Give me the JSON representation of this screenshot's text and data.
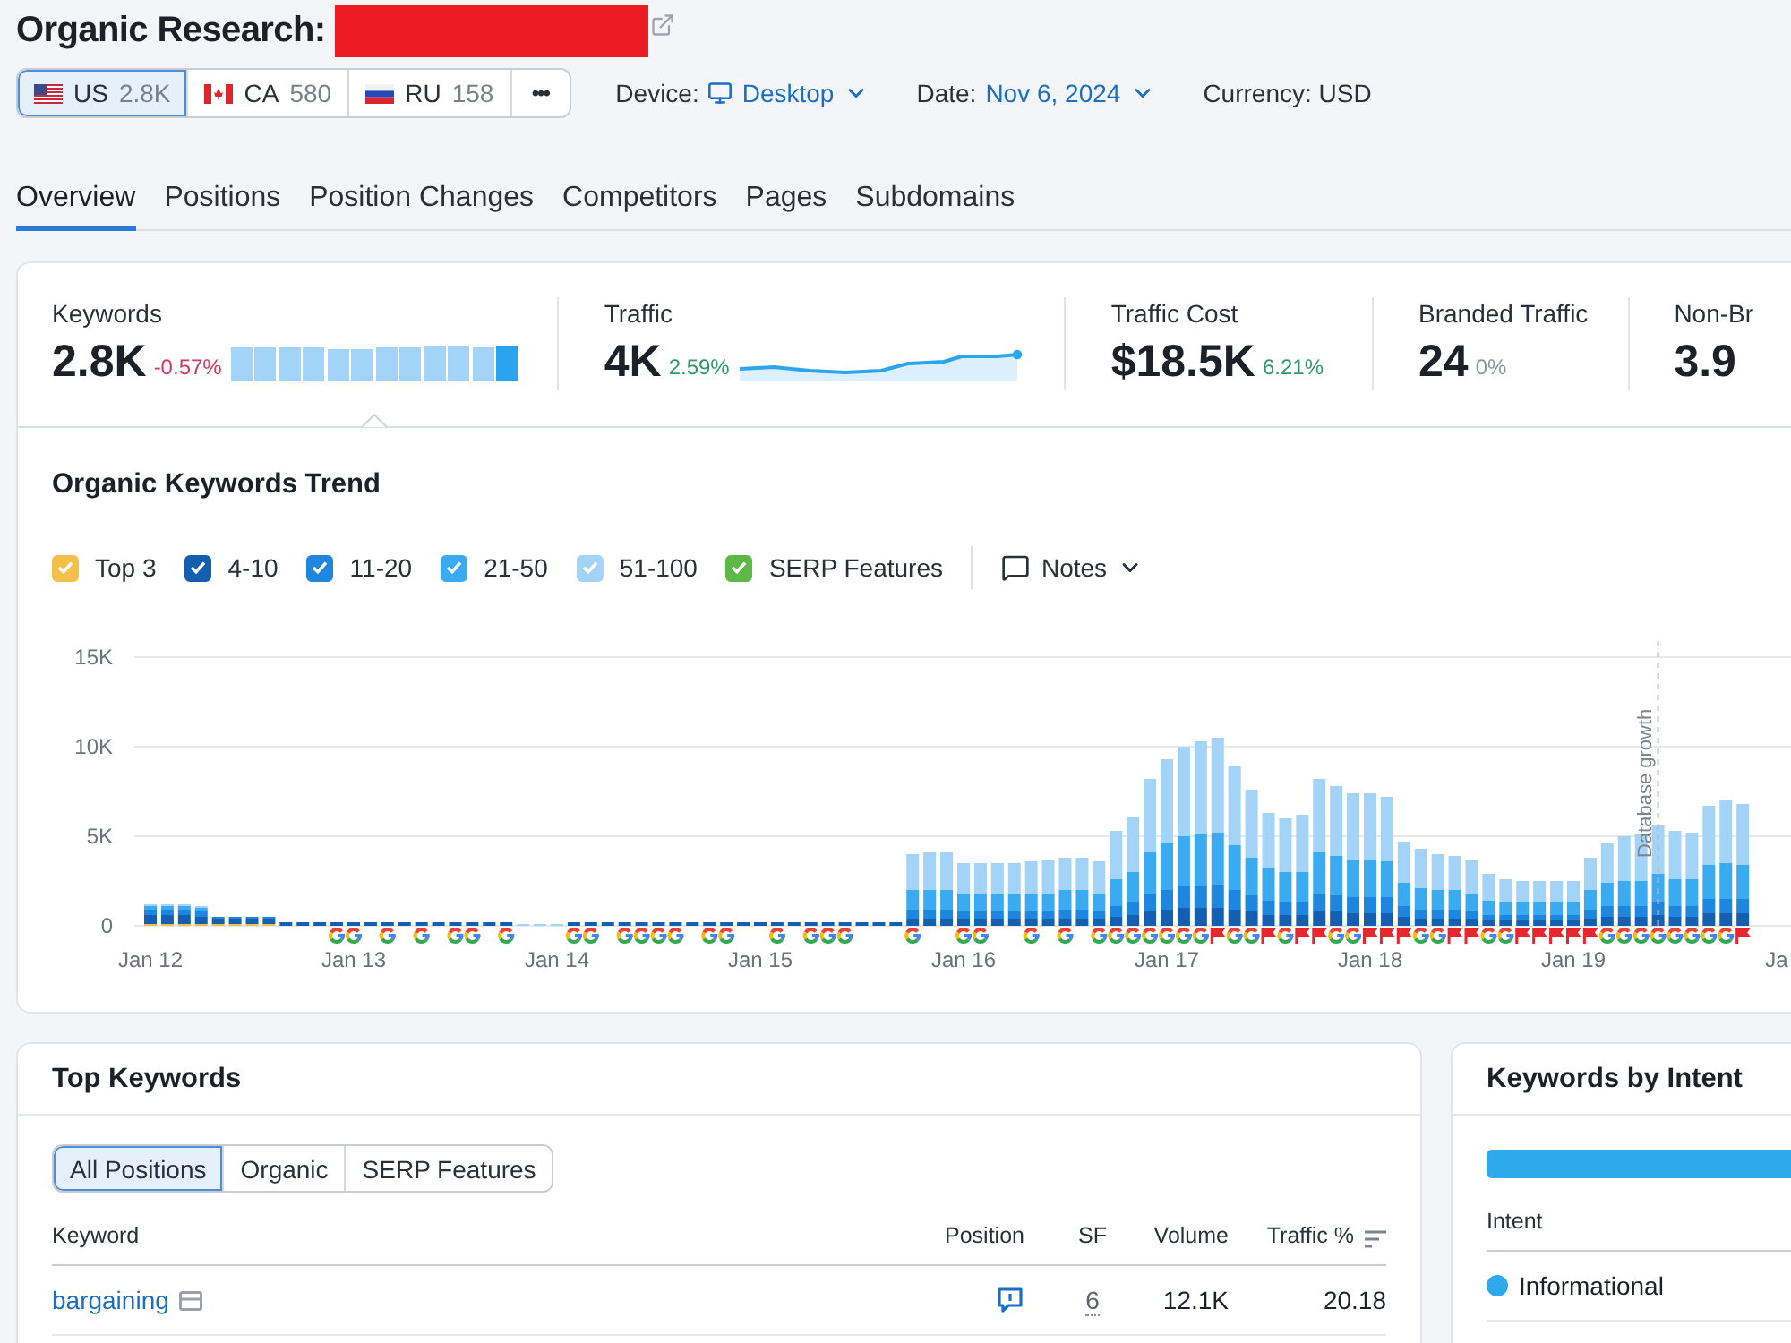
{
  "title": "Organic Research:",
  "domain": {
    "redacted": true
  },
  "databases": [
    {
      "code": "US",
      "count": "2.8K",
      "kind": "us",
      "selected": true
    },
    {
      "code": "CA",
      "count": "580",
      "kind": "ca",
      "selected": false
    },
    {
      "code": "RU",
      "count": "158",
      "kind": "ru",
      "selected": false
    }
  ],
  "more_button": {
    "label": "•••"
  },
  "device": {
    "label": "Device:",
    "value": "Desktop"
  },
  "date": {
    "label": "Date:",
    "value": "Nov 6, 2024"
  },
  "currency": {
    "text": "Currency: USD"
  },
  "tabs": [
    {
      "label": "Overview",
      "selected": true
    },
    {
      "label": "Positions",
      "selected": false
    },
    {
      "label": "Position Changes",
      "selected": false
    },
    {
      "label": "Competitors",
      "selected": false
    },
    {
      "label": "Pages",
      "selected": false
    },
    {
      "label": "Subdomains",
      "selected": false
    }
  ],
  "metrics": [
    {
      "label": "Keywords",
      "value": "2.8K",
      "change": {
        "text": "-0.57%",
        "color": "#d3385f"
      },
      "kind": "bars",
      "selected": true
    },
    {
      "label": "Traffic",
      "value": "4K",
      "change": {
        "text": "2.59%",
        "color": "#2e9a6b"
      },
      "kind": "sparkline",
      "selected": false
    },
    {
      "label": "Traffic Cost",
      "value": "$18.5K",
      "change": {
        "text": "6.21%",
        "color": "#2e9a6b"
      },
      "kind": "plain",
      "selected": false
    },
    {
      "label": "Branded Traffic",
      "value": "24",
      "change": {
        "text": "0%",
        "color": "#8d929c"
      },
      "kind": "plain",
      "selected": false
    },
    {
      "label": "Non-Br",
      "value": "3.9",
      "kind": "plain",
      "selected": false
    }
  ],
  "trend": {
    "title": "Organic Keywords Trend",
    "legend": [
      {
        "checked": true
      },
      {
        "checked": true
      },
      {
        "checked": true
      },
      {
        "checked": true
      },
      {
        "checked": true
      },
      {
        "label": "SERP Features",
        "checked": true,
        "color": "#5cb946"
      }
    ],
    "notes": {
      "label": "Notes"
    },
    "chart_data": {
      "type": "bar",
      "stacked": true,
      "categories": [
        "Jan 12",
        null,
        null,
        null,
        null,
        null,
        null,
        null,
        null,
        null,
        null,
        null,
        "Jan 13",
        null,
        null,
        null,
        null,
        null,
        null,
        null,
        null,
        null,
        null,
        null,
        "Jan 14",
        null,
        null,
        null,
        null,
        null,
        null,
        null,
        null,
        null,
        null,
        null,
        "Jan 15",
        null,
        null,
        null,
        null,
        null,
        null,
        null,
        null,
        null,
        null,
        null,
        "Jan 16",
        null,
        null,
        null,
        null,
        null,
        null,
        null,
        null,
        null,
        null,
        null,
        "Jan 17",
        null,
        null,
        null,
        null,
        null,
        null,
        null,
        null,
        null,
        null,
        null,
        "Jan 18",
        null,
        null,
        null,
        null,
        null,
        null,
        null,
        null,
        null,
        null,
        null,
        "Jan 19",
        null,
        null,
        null,
        null,
        null,
        null,
        null,
        null,
        null,
        null,
        null,
        "Ja"
      ],
      "ylim": [
        0,
        15
      ],
      "yticks": [
        {
          "value": 0,
          "label": "0"
        },
        {
          "value": 5,
          "label": "5K"
        },
        {
          "value": 10,
          "label": "10K"
        },
        {
          "value": 15,
          "label": "15K"
        }
      ],
      "series": [
        {
          "name": "Top 3",
          "color": "#f5c04a",
          "values": [
            0.1,
            0.1,
            0.1,
            0.1,
            0.1,
            0.1,
            0.1,
            0.1,
            0,
            0,
            0,
            0,
            0,
            0,
            0,
            0,
            0,
            0,
            0,
            0,
            0,
            0,
            0,
            0,
            0,
            0,
            0,
            0,
            0,
            0,
            0,
            0,
            0,
            0,
            0,
            0,
            0,
            0,
            0,
            0,
            0,
            0,
            0,
            0,
            0,
            0,
            0,
            0,
            0,
            0,
            0,
            0,
            0,
            0,
            0,
            0,
            0,
            0,
            0,
            0,
            0,
            0,
            0,
            0,
            0,
            0,
            0,
            0,
            0,
            0,
            0,
            0,
            0,
            0,
            0,
            0,
            0,
            0,
            0,
            0,
            0,
            0,
            0,
            0,
            0,
            0,
            0,
            0,
            0,
            0,
            0,
            0,
            0,
            0,
            0,
            null,
            null
          ]
        },
        {
          "name": "4-10",
          "color": "#155fb0",
          "values": [
            0.5,
            0.5,
            0.5,
            0.4,
            0.3,
            0.3,
            0.3,
            0.3,
            0.2,
            0.2,
            0.2,
            0.2,
            0.2,
            0.2,
            0.2,
            0.2,
            0.2,
            0.2,
            0.2,
            0.2,
            0.2,
            0.2,
            0,
            0,
            0,
            0.2,
            0.2,
            0.2,
            0.2,
            0.2,
            0.2,
            0.2,
            0.2,
            0.2,
            0.2,
            0.2,
            0.2,
            0.2,
            0.2,
            0.2,
            0.2,
            0.2,
            0.2,
            0.2,
            0.2,
            0.4,
            0.4,
            0.4,
            0.4,
            0.4,
            0.4,
            0.4,
            0.4,
            0.4,
            0.4,
            0.4,
            0.4,
            0.5,
            0.6,
            0.8,
            0.9,
            1.0,
            1.0,
            1.0,
            0.9,
            0.8,
            0.6,
            0.6,
            0.6,
            0.8,
            0.8,
            0.7,
            0.7,
            0.7,
            0.5,
            0.4,
            0.4,
            0.4,
            0.4,
            0.3,
            0.3,
            0.3,
            0.3,
            0.3,
            0.3,
            0.4,
            0.5,
            0.5,
            0.5,
            0.6,
            0.5,
            0.5,
            0.7,
            0.7,
            0.7,
            null,
            null
          ]
        },
        {
          "name": "11-20",
          "color": "#1f86e0",
          "values": [
            0.3,
            0.3,
            0.3,
            0.3,
            0.1,
            0.1,
            0.1,
            0.1,
            0,
            0,
            0,
            0,
            0,
            0,
            0,
            0,
            0,
            0,
            0,
            0,
            0,
            0,
            0,
            0,
            0,
            0,
            0,
            0,
            0,
            0,
            0,
            0,
            0,
            0,
            0,
            0,
            0,
            0,
            0,
            0,
            0,
            0,
            0,
            0,
            0,
            0.5,
            0.5,
            0.5,
            0.4,
            0.4,
            0.4,
            0.4,
            0.4,
            0.4,
            0.5,
            0.5,
            0.4,
            0.6,
            0.7,
            1.0,
            1.1,
            1.2,
            1.2,
            1.3,
            1.1,
            0.9,
            0.8,
            0.7,
            0.7,
            1.0,
            0.9,
            0.9,
            0.9,
            0.9,
            0.6,
            0.5,
            0.5,
            0.5,
            0.4,
            0.3,
            0.3,
            0.3,
            0.3,
            0.3,
            0.3,
            0.5,
            0.6,
            0.6,
            0.6,
            0.7,
            0.6,
            0.6,
            0.8,
            0.8,
            0.8,
            null,
            null
          ]
        },
        {
          "name": "21-50",
          "color": "#3aabf0",
          "values": [
            0.2,
            0.2,
            0.2,
            0.2,
            0,
            0,
            0,
            0,
            0,
            0,
            0,
            0,
            0,
            0,
            0,
            0,
            0,
            0,
            0,
            0,
            0,
            0,
            0,
            0,
            0,
            0,
            0,
            0,
            0,
            0,
            0,
            0,
            0,
            0,
            0,
            0,
            0,
            0,
            0,
            0,
            0,
            0,
            0,
            0,
            0,
            1.1,
            1.1,
            1.1,
            1.0,
            1.0,
            1.0,
            1.0,
            1.0,
            1.0,
            1.1,
            1.1,
            1.0,
            1.5,
            1.7,
            2.3,
            2.6,
            2.8,
            2.9,
            2.9,
            2.5,
            2.1,
            1.8,
            1.7,
            1.7,
            2.3,
            2.2,
            2.1,
            2.1,
            2.0,
            1.3,
            1.2,
            1.1,
            1.1,
            1.0,
            0.8,
            0.7,
            0.7,
            0.7,
            0.7,
            0.7,
            1.1,
            1.3,
            1.4,
            1.4,
            1.6,
            1.5,
            1.5,
            1.9,
            2.0,
            1.9,
            null,
            null
          ]
        },
        {
          "name": "51-100",
          "color": "#a3d4f8",
          "values": [
            0.1,
            0.1,
            0.1,
            0.1,
            0,
            0,
            0,
            0,
            0,
            0,
            0,
            0,
            0,
            0,
            0,
            0,
            0,
            0,
            0,
            0,
            0,
            0,
            0.1,
            0.1,
            0.1,
            0,
            0,
            0,
            0,
            0,
            0,
            0,
            0,
            0,
            0,
            0,
            0,
            0,
            0,
            0,
            0,
            0,
            0,
            0,
            0,
            2.0,
            2.1,
            2.1,
            1.7,
            1.7,
            1.7,
            1.7,
            1.8,
            1.9,
            1.8,
            1.8,
            1.8,
            2.7,
            3.1,
            4.1,
            4.7,
            5.0,
            5.2,
            5.3,
            4.4,
            3.8,
            3.1,
            3.0,
            3.2,
            4.1,
            3.9,
            3.7,
            3.7,
            3.6,
            2.3,
            2.2,
            2.0,
            1.9,
            1.9,
            1.5,
            1.3,
            1.2,
            1.2,
            1.2,
            1.2,
            1.8,
            2.2,
            2.5,
            2.6,
            2.7,
            2.7,
            2.6,
            3.3,
            3.5,
            3.4,
            null,
            null
          ]
        }
      ]
    },
    "serp_markers": [
      {
        "kind": "none"
      },
      {
        "kind": "none"
      },
      {
        "kind": "none"
      },
      {
        "kind": "none"
      },
      {
        "kind": "none"
      },
      {
        "kind": "none"
      },
      {
        "kind": "none"
      },
      {
        "kind": "none"
      },
      {
        "kind": "none"
      },
      {
        "kind": "none"
      },
      {
        "kind": "none"
      },
      {
        "kind": "g"
      },
      {
        "kind": "g"
      },
      {
        "kind": "none"
      },
      {
        "kind": "g"
      },
      {
        "kind": "none"
      },
      {
        "kind": "g"
      },
      {
        "kind": "none"
      },
      {
        "kind": "g"
      },
      {
        "kind": "g"
      },
      {
        "kind": "none"
      },
      {
        "kind": "g"
      },
      {
        "kind": "none"
      },
      {
        "kind": "none"
      },
      {
        "kind": "none"
      },
      {
        "kind": "g"
      },
      {
        "kind": "g"
      },
      {
        "kind": "none"
      },
      {
        "kind": "g"
      },
      {
        "kind": "g"
      },
      {
        "kind": "g"
      },
      {
        "kind": "g"
      },
      {
        "kind": "none"
      },
      {
        "kind": "g"
      },
      {
        "kind": "g"
      },
      {
        "kind": "none"
      },
      {
        "kind": "none"
      },
      {
        "kind": "g"
      },
      {
        "kind": "none"
      },
      {
        "kind": "g"
      },
      {
        "kind": "g"
      },
      {
        "kind": "g"
      },
      {
        "kind": "none"
      },
      {
        "kind": "none"
      },
      {
        "kind": "none"
      },
      {
        "kind": "g"
      },
      {
        "kind": "none"
      },
      {
        "kind": "none"
      },
      {
        "kind": "g"
      },
      {
        "kind": "g"
      },
      {
        "kind": "none"
      },
      {
        "kind": "none"
      },
      {
        "kind": "g"
      },
      {
        "kind": "none"
      },
      {
        "kind": "g"
      },
      {
        "kind": "none"
      },
      {
        "kind": "g"
      },
      {
        "kind": "g"
      },
      {
        "kind": "g"
      },
      {
        "kind": "g"
      },
      {
        "kind": "g"
      },
      {
        "kind": "g"
      },
      {
        "kind": "g"
      },
      {
        "kind": "flag"
      },
      {
        "kind": "g"
      },
      {
        "kind": "g"
      },
      {
        "kind": "flag"
      },
      {
        "kind": "g"
      },
      {
        "kind": "flag"
      },
      {
        "kind": "flag"
      },
      {
        "kind": "g"
      },
      {
        "kind": "g"
      },
      {
        "kind": "flag"
      },
      {
        "kind": "flag"
      },
      {
        "kind": "flag"
      },
      {
        "kind": "g"
      },
      {
        "kind": "g"
      },
      {
        "kind": "flag"
      },
      {
        "kind": "flag"
      },
      {
        "kind": "g"
      },
      {
        "kind": "g"
      },
      {
        "kind": "flag"
      },
      {
        "kind": "flag"
      },
      {
        "kind": "flag"
      },
      {
        "kind": "flag"
      },
      {
        "kind": "flag"
      },
      {
        "kind": "g"
      },
      {
        "kind": "g"
      },
      {
        "kind": "g"
      },
      {
        "kind": "g",
        "note": "Database growth"
      },
      {
        "kind": "g"
      },
      {
        "kind": "g"
      },
      {
        "kind": "g"
      },
      {
        "kind": "g"
      },
      {
        "kind": "flag"
      }
    ]
  },
  "top_keywords": {
    "title": "Top Keywords",
    "filters": [
      {
        "label": "All Positions",
        "selected": true
      },
      {
        "label": "Organic",
        "selected": false
      },
      {
        "label": "SERP Features",
        "selected": false
      }
    ],
    "columns": [
      {
        "label": "Keyword",
        "sorted": false
      },
      {
        "label": "Position",
        "sorted": false
      },
      {
        "label": "SF",
        "sorted": false
      },
      {
        "label": "Volume",
        "sorted": false
      },
      {
        "label": "Traffic %",
        "sorted": true
      }
    ],
    "rows": [
      {
        "keyword": "bargaining",
        "sf": "6",
        "volume": "12.1K",
        "traffic_share": "20.18"
      }
    ]
  },
  "intent": {
    "title": "Keywords by Intent",
    "column": "Intent",
    "rows": [
      {
        "label": "Informational",
        "color": "#2fa8ec"
      }
    ]
  }
}
